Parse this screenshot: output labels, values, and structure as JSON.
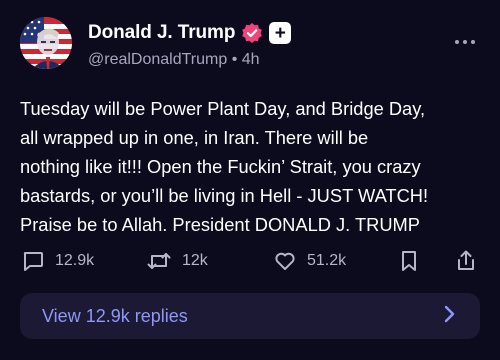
{
  "author": {
    "display_name": "Donald J. Trump",
    "handle": "@realDonaldTrump",
    "separator": "•",
    "time_ago": "4h",
    "plus_badge": "+"
  },
  "post": {
    "text": "Tuesday will be Power Plant Day, and Bridge Day,\nall wrapped up in one, in Iran. There will be\nnothing like it!!! Open the Fuckin’ Strait, you crazy\nbastards, or you’ll be living in Hell - JUST WATCH!\nPraise be to Allah. President DONALD J. TRUMP"
  },
  "actions": {
    "reply_count": "12.9k",
    "repost_count": "12k",
    "like_count": "51.2k"
  },
  "replies": {
    "label": "View 12.9k replies"
  },
  "icons": {
    "avatar": "portrait-with-flag",
    "verified": "verified-badge-icon",
    "plus": "plus-badge-icon",
    "more": "more-horizontal-icon",
    "reply": "comment-icon",
    "repost": "repost-icon",
    "like": "heart-icon",
    "bookmark": "bookmark-icon",
    "share": "share-icon",
    "chevron": "chevron-right-icon"
  },
  "colors": {
    "background": "#0c0a1d",
    "text": "#ffffff",
    "secondary": "#a8a6bd",
    "verified": "#f0447a",
    "link": "#8f97f7",
    "replies_bar": "#1b1934"
  }
}
